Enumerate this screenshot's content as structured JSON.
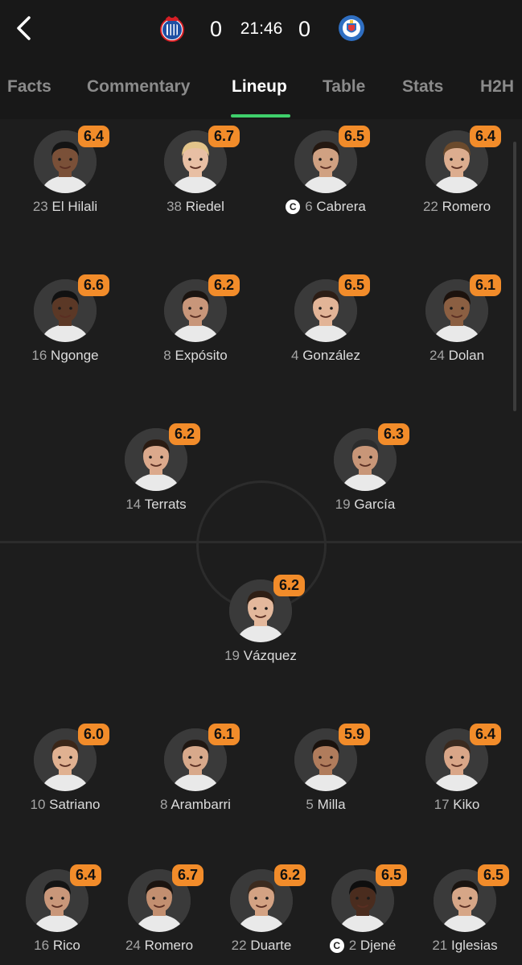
{
  "match": {
    "home_score": "0",
    "away_score": "0",
    "clock": "21:46",
    "home_crest_icon": "espanyol-crest-icon",
    "away_crest_icon": "getafe-crest-icon"
  },
  "tabs": [
    "Facts",
    "Commentary",
    "Lineup",
    "Table",
    "Stats",
    "H2H"
  ],
  "active_tab": "Lineup",
  "colors": {
    "accent": "#3fcf6b",
    "rating_badge": "#f28c2a",
    "background": "#1d1d1d"
  },
  "home_lineup": [
    [
      {
        "number": "23",
        "name": "El Hilali",
        "rating": "6.4",
        "captain": false,
        "skin": "#7a5038",
        "hair": "#141414"
      },
      {
        "number": "38",
        "name": "Riedel",
        "rating": "6.7",
        "captain": false,
        "skin": "#e8bfa4",
        "hair": "#e3c48a"
      },
      {
        "number": "6",
        "name": "Cabrera",
        "rating": "6.5",
        "captain": true,
        "skin": "#d0a182",
        "hair": "#241811"
      },
      {
        "number": "22",
        "name": "Romero",
        "rating": "6.4",
        "captain": false,
        "skin": "#dcad8f",
        "hair": "#6b4a2c"
      }
    ],
    [
      {
        "number": "16",
        "name": "Ngonge",
        "rating": "6.6",
        "captain": false,
        "skin": "#5b3826",
        "hair": "#111111"
      },
      {
        "number": "8",
        "name": "Expósito",
        "rating": "6.2",
        "captain": false,
        "skin": "#c8967a",
        "hair": "#1b1410"
      },
      {
        "number": "4",
        "name": "González",
        "rating": "6.5",
        "captain": false,
        "skin": "#e2b497",
        "hair": "#2c1d15"
      },
      {
        "number": "24",
        "name": "Dolan",
        "rating": "6.1",
        "captain": false,
        "skin": "#8b5f42",
        "hair": "#1c120d"
      }
    ],
    [
      {
        "number": "14",
        "name": "Terrats",
        "rating": "6.2",
        "captain": false,
        "skin": "#dba98c",
        "hair": "#2a1b12"
      },
      {
        "number": "19",
        "name": "García",
        "rating": "6.3",
        "captain": false,
        "skin": "#c89678",
        "hair": "#2c2c2c"
      }
    ]
  ],
  "away_lineup": [
    [
      {
        "number": "19",
        "name": "Vázquez",
        "rating": "6.2",
        "captain": false,
        "skin": "#e3b89c",
        "hair": "#2e1e14"
      }
    ],
    [
      {
        "number": "10",
        "name": "Satriano",
        "rating": "6.0",
        "captain": false,
        "skin": "#e0b191",
        "hair": "#3a2618"
      },
      {
        "number": "8",
        "name": "Arambarri",
        "rating": "6.1",
        "captain": false,
        "skin": "#d8a98b",
        "hair": "#1f1712"
      },
      {
        "number": "5",
        "name": "Milla",
        "rating": "5.9",
        "captain": false,
        "skin": "#b07c5c",
        "hair": "#1a120d"
      },
      {
        "number": "17",
        "name": "Kiko",
        "rating": "6.4",
        "captain": false,
        "skin": "#d9a688",
        "hair": "#3a2a1f"
      }
    ],
    [
      {
        "number": "16",
        "name": "Rico",
        "rating": "6.4",
        "captain": false,
        "skin": "#c9977a",
        "hair": "#141414"
      },
      {
        "number": "24",
        "name": "Romero",
        "rating": "6.7",
        "captain": false,
        "skin": "#c28f70",
        "hair": "#1b1410"
      },
      {
        "number": "22",
        "name": "Duarte",
        "rating": "6.2",
        "captain": false,
        "skin": "#d3a283",
        "hair": "#3b2a1e"
      },
      {
        "number": "2",
        "name": "Djené",
        "rating": "6.5",
        "captain": true,
        "skin": "#4a2c1e",
        "hair": "#0e0e0e"
      },
      {
        "number": "21",
        "name": "Iglesias",
        "rating": "6.5",
        "captain": false,
        "skin": "#d6a687",
        "hair": "#1a1410"
      }
    ]
  ]
}
